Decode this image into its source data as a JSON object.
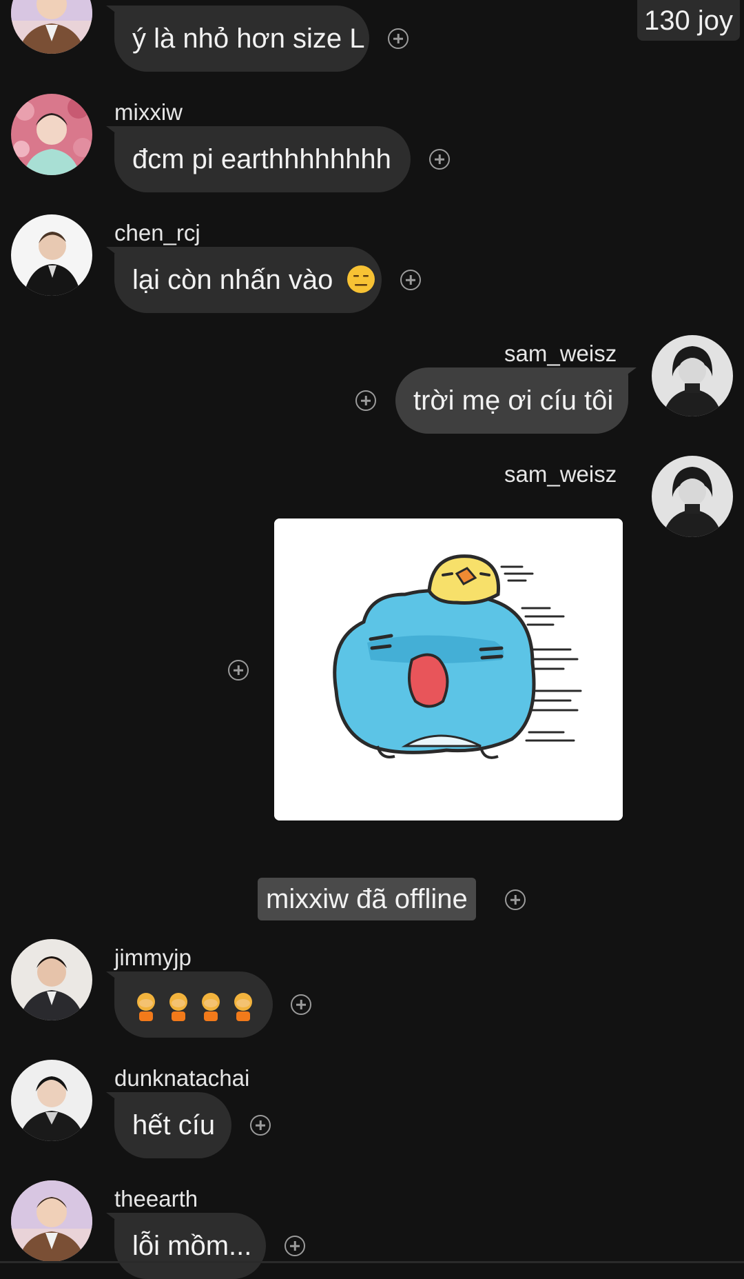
{
  "header": {
    "points_text": "130 joy"
  },
  "messages": [
    {
      "username": "",
      "text": "ý là nhỏ hơn size L",
      "avatar": "man-brown-suit-avatar"
    },
    {
      "username": "mixxiw",
      "text": "đcm pi earthhhhhhhh",
      "avatar": "man-pink-flowers-avatar"
    },
    {
      "username": "chen_rcj",
      "text": "lại còn nhấn vào",
      "emoji": "neutral-face-emoji",
      "avatar": "man-black-suit-avatar"
    },
    {
      "username": "sam_weisz",
      "text": "trời mẹ ơi cíu tôi",
      "avatar": "woman-black-turtleneck-avatar"
    },
    {
      "username": "sam_weisz",
      "sticker": "blue-cat-with-yellow-bird-sticker",
      "avatar": "woman-black-turtleneck-avatar"
    },
    {
      "system_text": "mixxiw đã offline"
    },
    {
      "username": "jimmyjp",
      "emoji_row": [
        "facepalm-emoji",
        "facepalm-emoji",
        "facepalm-emoji",
        "facepalm-emoji"
      ],
      "avatar": "man-dark-suit-avatar"
    },
    {
      "username": "dunknatachai",
      "text": "hết cíu",
      "avatar": "man-black-jacket-avatar"
    },
    {
      "username": "theearth",
      "text": "lỗi mồm...",
      "avatar": "man-brown-suit-avatar"
    }
  ],
  "colors": {
    "background": "#121212",
    "bubble_incoming": "#2d2d2d",
    "bubble_outgoing": "#3f3f3f",
    "system_badge": "#4a4a4a",
    "plus_icon": "#9b9b9b"
  }
}
